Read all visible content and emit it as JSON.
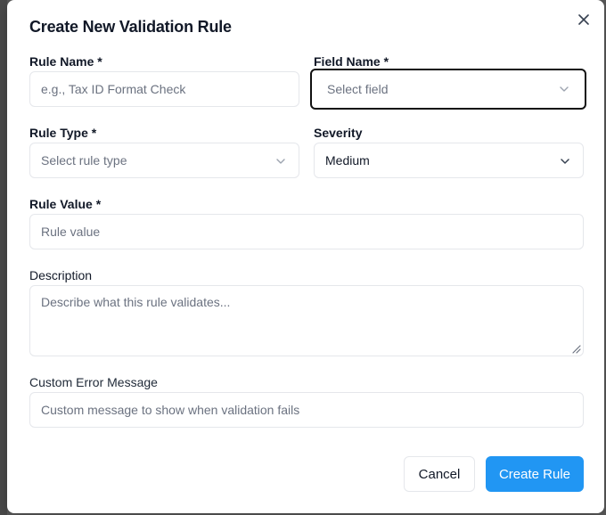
{
  "dialog": {
    "title": "Create New Validation Rule",
    "close_icon": "close-icon"
  },
  "form": {
    "rule_name": {
      "label": "Rule Name *",
      "placeholder": "e.g., Tax ID Format Check",
      "value": ""
    },
    "field_name": {
      "label": "Field Name *",
      "placeholder": "Select field",
      "value": ""
    },
    "rule_type": {
      "label": "Rule Type *",
      "placeholder": "Select rule type",
      "value": ""
    },
    "severity": {
      "label": "Severity",
      "value": "Medium"
    },
    "rule_value": {
      "label": "Rule Value *",
      "placeholder": "Rule value",
      "value": ""
    },
    "description": {
      "label": "Description",
      "placeholder": "Describe what this rule validates..."
    },
    "custom_error": {
      "label": "Custom Error Message",
      "placeholder": "Custom message to show when validation fails"
    }
  },
  "actions": {
    "cancel_label": "Cancel",
    "create_label": "Create Rule"
  },
  "colors": {
    "primary": "#2196f3",
    "border": "#e5e7eb",
    "focus_ring": "#111111"
  }
}
